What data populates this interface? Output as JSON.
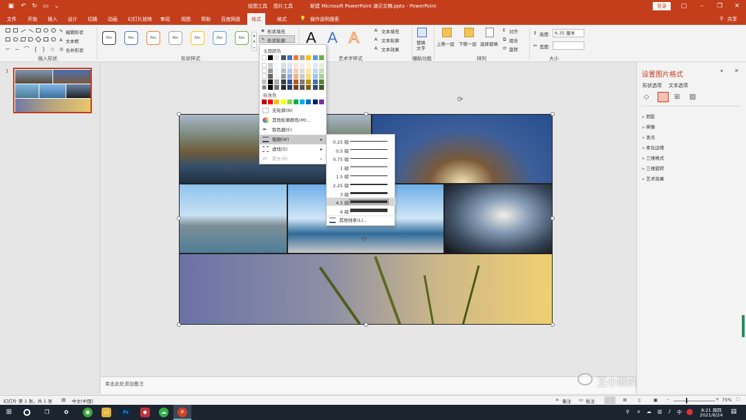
{
  "window": {
    "title": "新建 Microsoft PowerPoint 演示文稿.pptx  -  PowerPoint",
    "context_tabs": [
      "绘图工具",
      "图片工具"
    ],
    "login_label": "登录"
  },
  "ribbon_tabs": [
    "文件",
    "开始",
    "插入",
    "设计",
    "切换",
    "动画",
    "幻灯片放映",
    "审阅",
    "视图",
    "帮助",
    "百度网盘",
    "格式",
    "格式"
  ],
  "active_tab": "格式",
  "tell_me": "操作说明搜索",
  "share_label": "共享",
  "ribbon": {
    "insert_shapes_group": "插入形状",
    "edit_shape": "编辑形状",
    "text_box": "文本框",
    "merge_shapes": "合并形状",
    "shape_styles_group": "形状样式",
    "style_label": "Abc",
    "shape_fill": "形状填充",
    "shape_outline": "形状轮廓",
    "wordart_group": "艺术字样式",
    "text_fill": "文本填充",
    "text_outline": "文本轮廓",
    "text_effects": "文本效果",
    "accessibility_group": "辅助功能",
    "alt_text": "替换文字",
    "arrange_group": "排列",
    "bring_forward": "上移一层",
    "send_backward": "下移一层",
    "selection_pane": "选择窗格",
    "align": "对齐",
    "group": "组合",
    "rotate": "旋转",
    "size_group": "大小",
    "height_label": "高度:",
    "height_value": "6.35 厘米",
    "width_label": "宽度:",
    "width_value": ""
  },
  "outline_menu": {
    "theme_colors": "主题颜色",
    "standard_colors": "标准色",
    "no_outline": "无轮廓(N)",
    "more_colors": "其他轮廓颜色(M)...",
    "eyedropper": "取色器(E)",
    "weight": "粗细(W)",
    "dashes": "虚线(S)",
    "arrows": "箭头(R)"
  },
  "theme_palette": [
    "#ffffff",
    "#000000",
    "#e7e6e6",
    "#44546a",
    "#4472c4",
    "#ed7d31",
    "#a5a5a5",
    "#ffc000",
    "#5b9bd5",
    "#70ad47"
  ],
  "standard_palette": [
    "#c00000",
    "#ff0000",
    "#ffc000",
    "#ffff00",
    "#92d050",
    "#00b050",
    "#00b0f0",
    "#0070c0",
    "#002060",
    "#7030a0"
  ],
  "weights": [
    {
      "label": "0.25 磅",
      "pt": 0.25
    },
    {
      "label": "0.5 磅",
      "pt": 0.5
    },
    {
      "label": "0.75 磅",
      "pt": 0.75
    },
    {
      "label": "1 磅",
      "pt": 1
    },
    {
      "label": "1.5 磅",
      "pt": 1.5
    },
    {
      "label": "2.25 磅",
      "pt": 2.25
    },
    {
      "label": "3 磅",
      "pt": 3
    },
    {
      "label": "4.5 磅",
      "pt": 4.5
    },
    {
      "label": "6 磅",
      "pt": 6
    }
  ],
  "selected_weight": "4.5 磅",
  "more_lines": "其他线条(L)...",
  "slide_number": "1",
  "notes_placeholder": "单击此处添加备注",
  "format_pane": {
    "title": "设置图片格式",
    "tab_shape": "形状选项",
    "tab_text": "文本选项",
    "sections": [
      "阴影",
      "映像",
      "发光",
      "柔化边缘",
      "三维格式",
      "三维旋转",
      "艺术效果"
    ]
  },
  "status": {
    "slide_info": "幻灯片 第 1 张，共 1 张",
    "language": "中文(中国)",
    "notes": "备注",
    "comments": "批注",
    "zoom": "75%"
  },
  "watermark": "王小贱的炸货",
  "clock": {
    "time": "8:21 周四",
    "date": "2021/6/24"
  },
  "colors": {
    "accent": "#c43e1c"
  }
}
